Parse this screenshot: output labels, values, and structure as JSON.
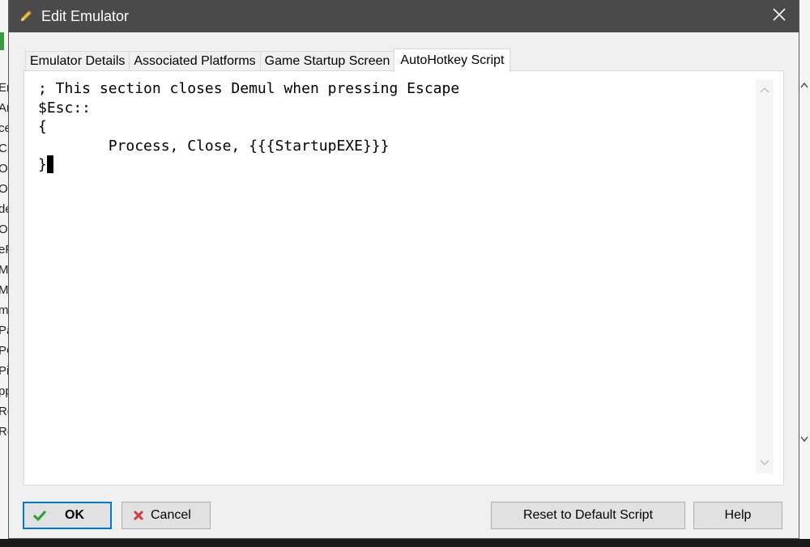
{
  "background": {
    "left_fragments": [
      "Er",
      "Ar",
      "ce",
      "Ci",
      "O",
      "O",
      "de",
      "O",
      "eF",
      "M",
      "M",
      "m",
      "Pa",
      "PC",
      "Pi",
      "pp",
      "Re",
      "Re"
    ]
  },
  "window": {
    "title": "Edit Emulator",
    "title_icon": "pencil-icon",
    "close_icon": "close-icon"
  },
  "tabs": [
    {
      "label": "Emulator Details",
      "active": false
    },
    {
      "label": "Associated Platforms",
      "active": false
    },
    {
      "label": "Game Startup Screen",
      "active": false
    },
    {
      "label": "AutoHotkey Script",
      "active": true
    }
  ],
  "editor": {
    "lines": [
      "; This section closes Demul when pressing Escape",
      "$Esc::",
      "{",
      "        Process, Close, {{{StartupEXE}}}",
      "}"
    ]
  },
  "buttons": {
    "ok": "OK",
    "cancel": "Cancel",
    "reset": "Reset to Default Script",
    "help": "Help"
  },
  "colors": {
    "titlebar": "#4a4a4a",
    "ok_border": "#0078d7",
    "ok_check": "#2e9e2e",
    "cancel_x": "#d63b3b"
  }
}
